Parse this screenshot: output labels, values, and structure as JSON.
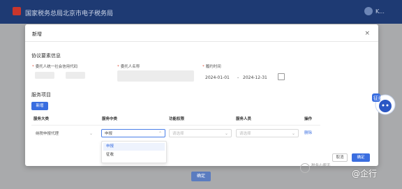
{
  "header": {
    "title": "国家税务总局北京市电子税务局",
    "user": "K..."
  },
  "modal": {
    "title": "新增",
    "close_label": "×",
    "agreement_section": "协议要素信息",
    "fields": {
      "client_id_label": "委托人统一社会信用代码",
      "client_name_label": "委托人名称",
      "period_label": "履约时间",
      "date_start": "2024-01-01",
      "date_sep": "-",
      "date_end": "2024-12-31"
    },
    "service_section": "服务项目",
    "add_button": "新增",
    "table": {
      "headers": [
        "服务大类",
        "服务中类",
        "功能权限",
        "服务人员",
        "操作"
      ],
      "row": {
        "category": "纳税申报代理",
        "subcategory": "申报",
        "permission_placeholder": "请选择",
        "staff_placeholder": "请选择",
        "action": "删除"
      }
    },
    "dropdown_options": [
      "申报",
      "征收"
    ],
    "cancel_button": "取消",
    "confirm_button": "确定"
  },
  "background_button": "确定",
  "mascot_text": "征纳",
  "watermark": "税务小帮手",
  "brand": "@企行",
  "colors": {
    "primary": "#3a6ee0",
    "header": "#1e3a73",
    "required": "#e0533c"
  }
}
